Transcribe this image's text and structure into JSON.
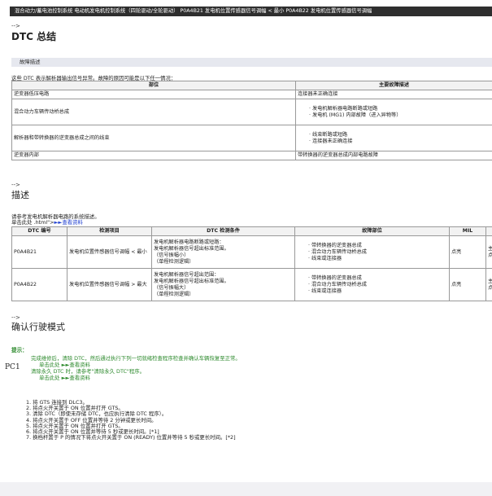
{
  "breadcrumb": "混合动力/蓄电池控制系统  电动机发电机控制系统（四轮驱动/全轮驱动）  P0A4B21 发电机位置传感器信号调幅 < 最小  P0A4B22 发电机位置传感器信号调幅",
  "arrow": "-->",
  "dtc_summary": {
    "title": "DTC 总结",
    "bar": "故障描述",
    "intro": "这些 DTC 表示解析器输出信号异常。故障的原因可能是以下任一情况：",
    "headers": [
      "部位",
      "主要故障描述"
    ],
    "rows": [
      {
        "part": "逆变器低压电路",
        "desc": [
          "连接器未正确连接"
        ],
        "bullet": false
      },
      {
        "part": "混合动力车辆传动桥总成",
        "desc": [
          "发电机解析器电路断路或短路",
          "发电机 (MG1) 内部故障（进入异物等）"
        ],
        "bullet": true
      },
      {
        "part": "解析器和带转换器的逆变器总成之间的线束",
        "desc": [
          "线束断路或短路",
          "连接器未正确连接"
        ],
        "bullet": true
      },
      {
        "part": "逆变器内部",
        "desc": [
          "带转换器的逆变器总成内部电路故障"
        ],
        "bullet": false
      }
    ]
  },
  "description": {
    "title": "描述",
    "text": "请参考发电机解析器电路的系统描述。",
    "link_prefix": "单击此处 .html\">",
    "link": "►►查看资料",
    "headers": [
      "DTC 编号",
      "检测项目",
      "DTC 检测条件",
      "故障部位",
      "MIL",
      ""
    ],
    "rows": [
      {
        "code": "P0A4B21",
        "item": "发电机位置传感器信号调幅 < 最小",
        "cond": [
          "发电机解析器电路断路或短路：",
          "发电机解析器信号超出标准范围。",
          "（信号振幅小）",
          "（单程检测逻辑）"
        ],
        "parts": [
          "带转换器的逆变器总成",
          "混合动力车辆传动桥总成",
          "线束或连接器"
        ],
        "mil": "点亮",
        "extra": "主\n点"
      },
      {
        "code": "P0A4B22",
        "item": "发电机位置传感器信号调幅 > 最大",
        "cond": [
          "发电机解析器信号超出范围：",
          "发电机解析器信号超出标准范围。",
          "（信号振幅大）",
          "（单程检测逻辑）"
        ],
        "parts": [
          "带转换器的逆变器总成",
          "混合动力车辆传动桥总成",
          "线束或连接器"
        ],
        "mil": "点亮",
        "extra": "主\n点"
      }
    ]
  },
  "confirm": {
    "title": "确认行驶模式",
    "hint": "提示：",
    "notes": [
      "完成维修后，清除 DTC，然后通过执行下列一切就绪检查程序检查并确认车辆恢复至正常。",
      "单击此处 ►►查看资料",
      "清除永久 DTC 时，请参考\"清除永久 DTC\"程序。",
      "单击此处 ►►查看资料"
    ],
    "pc1": "PC1",
    "steps": [
      "1.   将 GTS 连接到 DLC3。",
      "2.   将点火开关置于 ON 位置并打开 GTS。",
      "3.   清除 DTC（即使未存储 DTC，也应执行清除 DTC 程序）。",
      "4.   将点火开关置于 OFF 位置并等待 2 分钟或更长时间。",
      "5.   将点火开关置于 ON 位置并打开 GTS。",
      "6.   将点火开关置于 ON 位置并等待 5 秒或更长时间。[*1]",
      "7.   换档杆置于 P 的情况下将点火开关置于 ON (READY) 位置并等待 5 秒或更长时间。[*2]"
    ]
  }
}
